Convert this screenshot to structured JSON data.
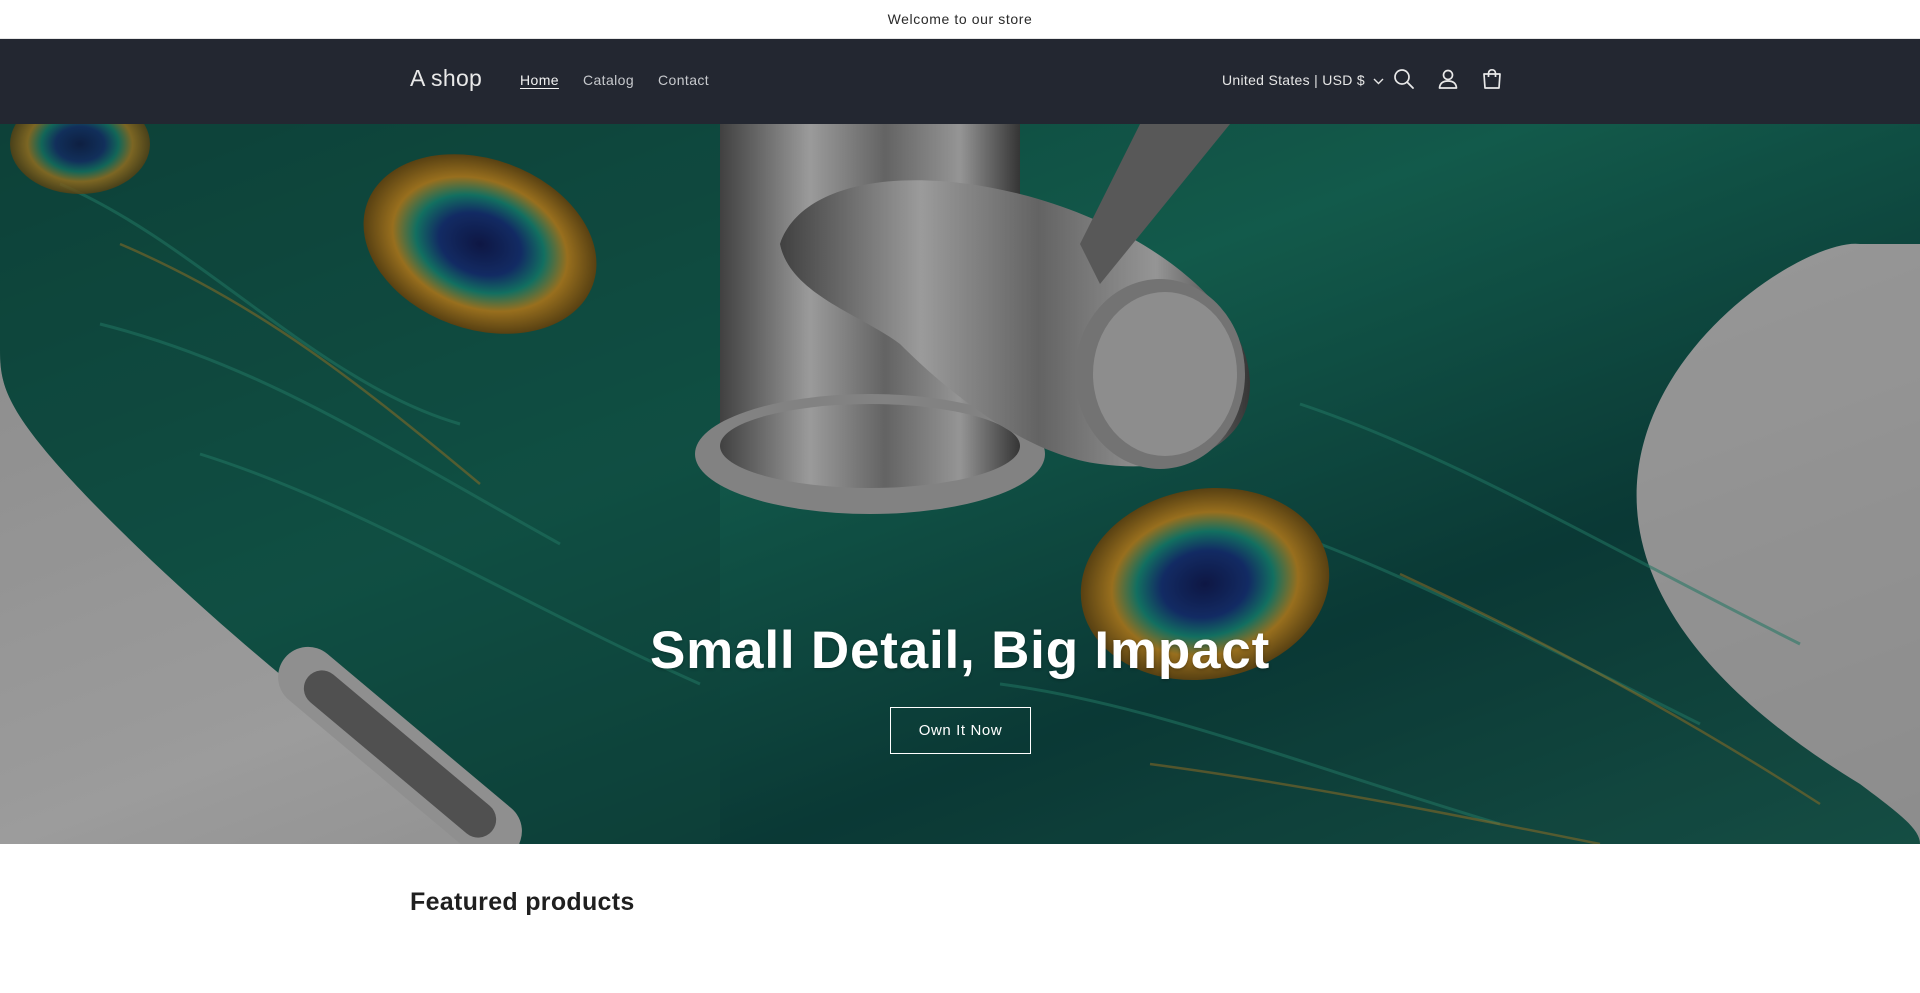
{
  "announcement": {
    "text": "Welcome to our store"
  },
  "header": {
    "logo": "A shop",
    "nav": [
      {
        "label": "Home",
        "active": true
      },
      {
        "label": "Catalog",
        "active": false
      },
      {
        "label": "Contact",
        "active": false
      }
    ],
    "locale": "United States | USD $",
    "icons": [
      "search-icon",
      "account-icon",
      "cart-icon",
      "chevron-down-icon"
    ]
  },
  "hero": {
    "title": "Small Detail, Big Impact",
    "button_label": "Own It Now"
  },
  "featured": {
    "title": "Featured products"
  },
  "colors": {
    "header_bg": "#232731",
    "peacock_teal": "#1f8f7a",
    "peacock_gold": "#d99a2b",
    "peacock_blue": "#1a2f7a"
  }
}
